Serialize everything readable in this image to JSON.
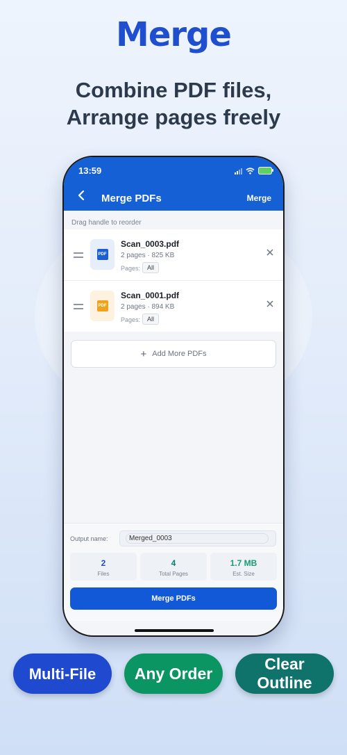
{
  "promo": {
    "headline": "Merge",
    "subline1": "Combine PDF files,",
    "subline2": "Arrange pages freely",
    "pills": [
      "Multi-File",
      "Any Order",
      "Clear Outline"
    ],
    "colors": {
      "headline": "#1f4fcf",
      "pill_blue": "#1f49cf",
      "pill_green": "#0b9563",
      "pill_teal": "#0f736c"
    }
  },
  "status_bar": {
    "time": "13:59"
  },
  "nav": {
    "back_icon": "chevron-left-icon",
    "title": "Merge PDFs",
    "action": "Merge",
    "color": "#1560d4"
  },
  "hint": "Drag handle to reorder",
  "files": [
    {
      "name": "Scan_0003.pdf",
      "meta": "2 pages · 825 KB",
      "pages_label": "Pages:",
      "pages_value": "All",
      "icon": "pdf-icon",
      "icon_color": "#1d5fd3"
    },
    {
      "name": "Scan_0001.pdf",
      "meta": "2 pages · 894 KB",
      "pages_label": "Pages:",
      "pages_value": "All",
      "icon": "pdf-icon",
      "icon_color": "#f0a21b"
    }
  ],
  "add_more": {
    "label": "Add More PDFs"
  },
  "output": {
    "label": "Output name:",
    "value": "Merged_0003"
  },
  "stats": [
    {
      "value": "2",
      "label": "Files"
    },
    {
      "value": "4",
      "label": "Total Pages"
    },
    {
      "value": "1.7 MB",
      "label": "Est. Size"
    }
  ],
  "merge_button": {
    "label": "Merge PDFs"
  }
}
